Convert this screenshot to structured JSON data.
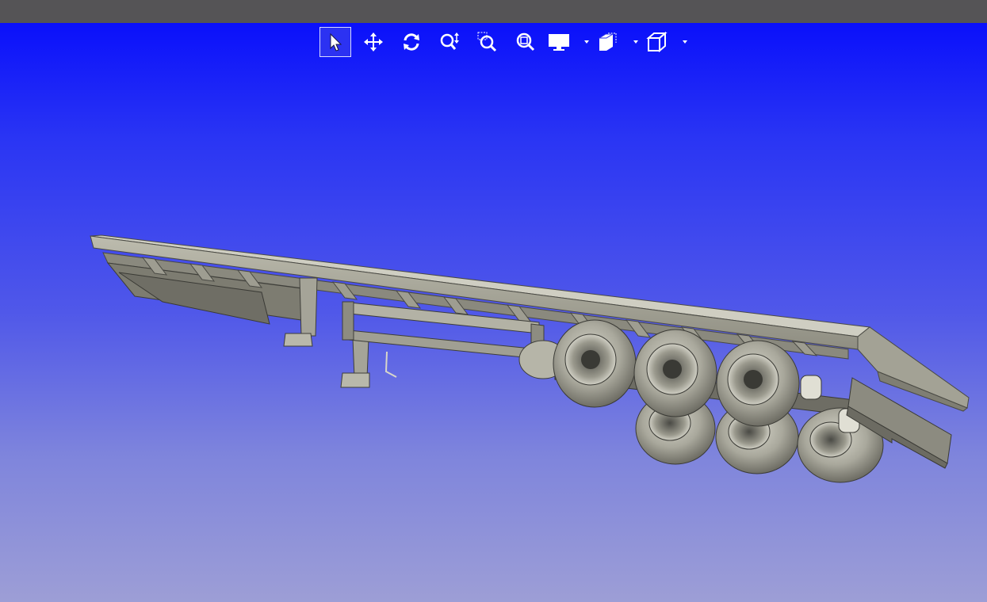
{
  "toolbar": {
    "tools": [
      {
        "name": "select",
        "icon": "select-arrow-icon",
        "active": true
      },
      {
        "name": "pan",
        "icon": "pan-move-icon",
        "active": false
      },
      {
        "name": "rotate",
        "icon": "rotate-icon",
        "active": false
      },
      {
        "name": "zoom",
        "icon": "zoom-updown-icon",
        "active": false
      },
      {
        "name": "zoom-window",
        "icon": "zoom-window-icon",
        "active": false
      },
      {
        "name": "zoom-fit",
        "icon": "zoom-fit-icon",
        "active": false
      },
      {
        "name": "display-mode",
        "icon": "monitor-icon",
        "dropdown": true
      },
      {
        "name": "section-view",
        "icon": "section-plane-icon",
        "dropdown": true
      },
      {
        "name": "view-orientation",
        "icon": "cube-view-icon",
        "dropdown": true
      }
    ]
  },
  "colors": {
    "titlebar": "#555456",
    "viewport_top": "#0a10fb",
    "viewport_bottom": "#9d9ed6",
    "model_body": "#a9a89a",
    "model_dark": "#5f5e55",
    "icon": "#ffffff"
  },
  "model": {
    "description_icon": "semi-trailer-3d-model"
  }
}
